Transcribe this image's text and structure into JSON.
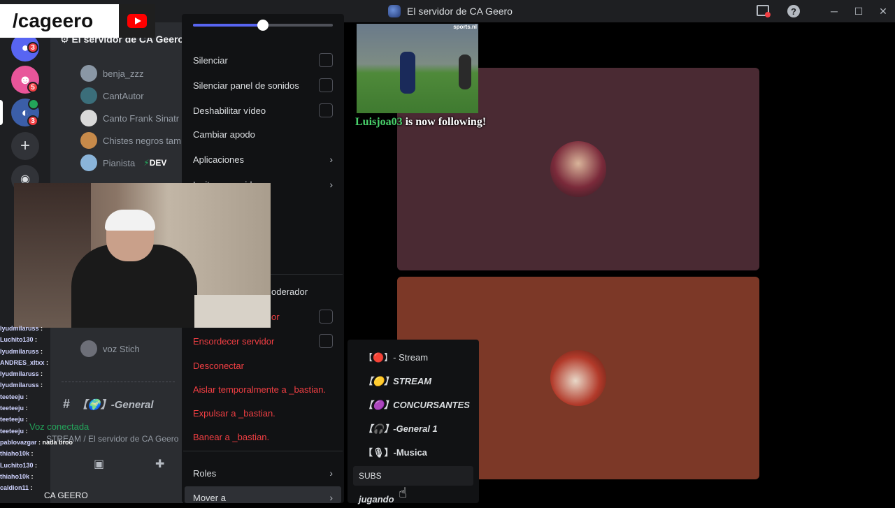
{
  "window": {
    "title": "El servidor de CA Geero"
  },
  "brand": {
    "handle": "/cageero"
  },
  "server": {
    "name": "El servidor de CA Geero"
  },
  "rail": {
    "badges": [
      "3",
      "5",
      "3"
    ]
  },
  "members": [
    {
      "name": "benja_zzz",
      "color": "#8a97a5"
    },
    {
      "name": "CantAutor",
      "color": "#3b6e7a"
    },
    {
      "name": "Canto Frank Sinatr",
      "color": "#d9d9d9"
    },
    {
      "name": "Chistes negros tam",
      "color": "#c78a4a"
    },
    {
      "name": "Pianista",
      "color": "#8ab4d9",
      "tag": "DEV"
    }
  ],
  "lower_member": "voz Stich",
  "channel": {
    "general": "【🌍】-General"
  },
  "voice": {
    "status": "Voz conectada",
    "location": "STREAM / El servidor de CA Geero"
  },
  "user_name": "CA GEERO",
  "menu": {
    "items": [
      {
        "label": "Silenciar",
        "type": "check"
      },
      {
        "label": "Silenciar panel de sonidos",
        "type": "check"
      },
      {
        "label": "Deshabilitar vídeo",
        "type": "check"
      },
      {
        "label": "Cambiar apodo",
        "type": "plain"
      },
      {
        "label": "Aplicaciones",
        "type": "sub"
      },
      {
        "label": "Invitar a servidor",
        "type": "sub"
      }
    ],
    "moderator": "oderador",
    "partial_item": "or",
    "danger_items": [
      {
        "label": "Ensordecer servidor",
        "check": true
      },
      {
        "label": "Desconectar",
        "check": false
      },
      {
        "label": "Aislar temporalmente a _bastian.",
        "check": false
      },
      {
        "label": "Expulsar a _bastian.",
        "check": false
      },
      {
        "label": "Banear a _bastian.",
        "check": false
      }
    ],
    "roles": "Roles",
    "move_to": "Mover a"
  },
  "submenu": {
    "items": [
      {
        "label": "【🔴】- Stream",
        "style": "plain"
      },
      {
        "label": "【🟡】STREAM",
        "style": "bold-italic"
      },
      {
        "label": "【🟣】CONCURSANTES",
        "style": "bold-italic"
      },
      {
        "label": "【🎧】-General 1",
        "style": "bold-italic"
      },
      {
        "label": "【🎙】-Musica",
        "style": "bold"
      }
    ],
    "subs": "SUBS",
    "jugando": "jugando"
  },
  "overlay": {
    "follower": "Luisjoa03",
    "follow_text": " is now following!",
    "video_watermark": "sports.nl"
  },
  "chat": [
    {
      "user": "lyudmilaruss",
      "msg": ""
    },
    {
      "user": "Luchito130",
      "msg": ""
    },
    {
      "user": "lyudmilaruss",
      "msg": ""
    },
    {
      "user": "ANDRES_xltxx",
      "msg": ""
    },
    {
      "user": "lyudmilaruss",
      "msg": ""
    },
    {
      "user": "lyudmilaruss",
      "msg": ""
    },
    {
      "user": "teeteeju",
      "msg": ""
    },
    {
      "user": "teeteeju",
      "msg": ""
    },
    {
      "user": "teeteeju",
      "msg": ""
    },
    {
      "user": "teeteeju",
      "msg": ""
    },
    {
      "user": "pablovazgar",
      "msg": "nada broo"
    },
    {
      "user": "thiaho10k",
      "msg": ""
    },
    {
      "user": "Luchito130",
      "msg": ""
    },
    {
      "user": "thiaho10k",
      "msg": ""
    },
    {
      "user": "caldion11",
      "msg": ""
    }
  ],
  "colors": {
    "danger": "#f23f43",
    "accent": "#5865f2",
    "tile_top": "#4a2a33",
    "tile_bottom": "#7c3827"
  }
}
